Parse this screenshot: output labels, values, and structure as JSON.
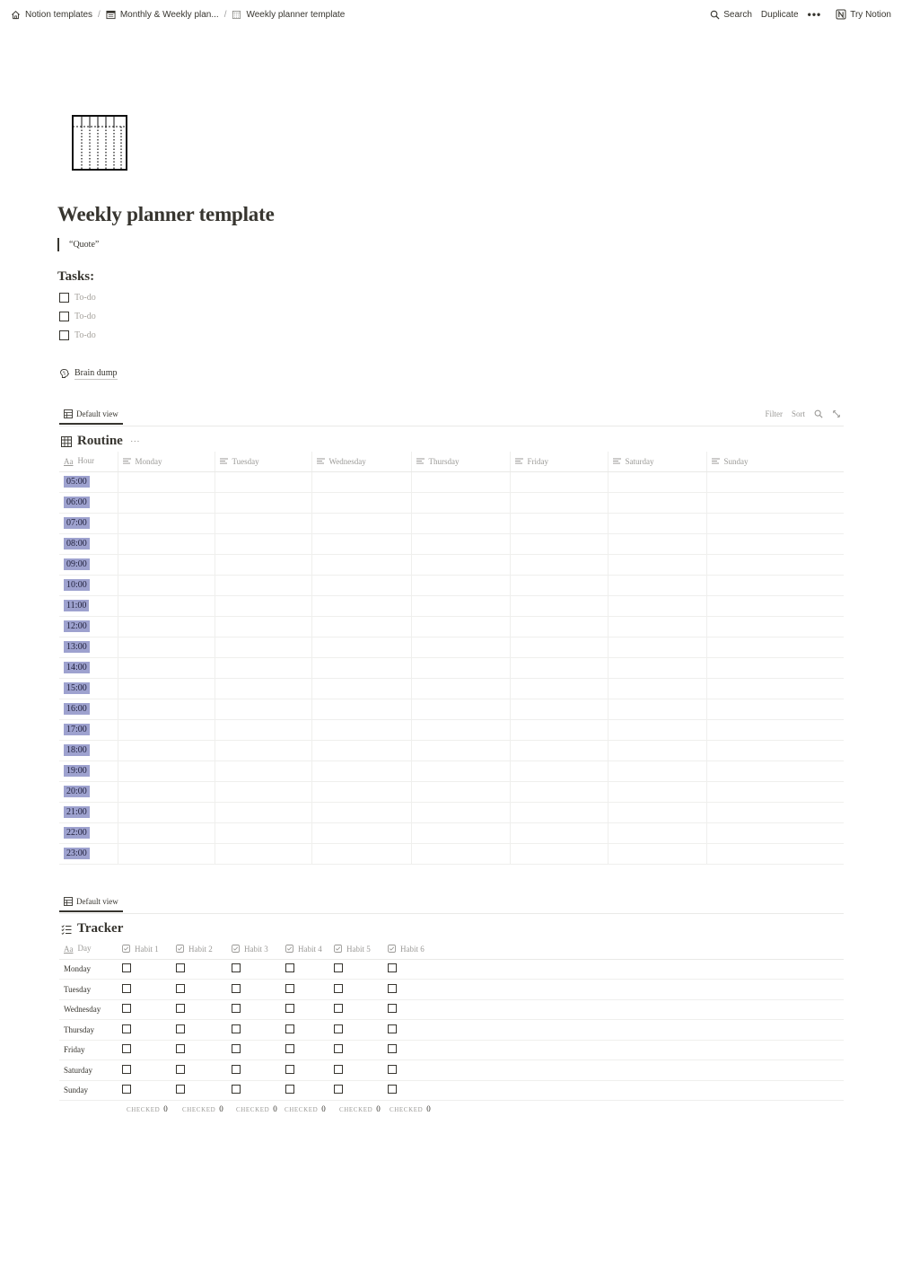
{
  "breadcrumbs": [
    {
      "label": "Notion templates",
      "icon": "home-icon"
    },
    {
      "label": "Monthly & Weekly plan...",
      "icon": "calendar-icon"
    },
    {
      "label": "Weekly planner template",
      "icon": "page-icon"
    }
  ],
  "topbar": {
    "search": "Search",
    "duplicate": "Duplicate",
    "more": "•••",
    "try_notion": "Try Notion"
  },
  "page": {
    "title": "Weekly planner template",
    "quote": "“Quote”",
    "tasks_heading": "Tasks:",
    "todos": [
      "To-do",
      "To-do",
      "To-do"
    ],
    "brain_dump": "Brain dump"
  },
  "routine": {
    "view_tab": "Default view",
    "tools": {
      "filter": "Filter",
      "sort": "Sort"
    },
    "title": "Routine",
    "more": "···",
    "columns": [
      "Hour",
      "Monday",
      "Tuesday",
      "Wednesday",
      "Thursday",
      "Friday",
      "Saturday",
      "Sunday"
    ],
    "hours": [
      "05:00",
      "06:00",
      "07:00",
      "08:00",
      "09:00",
      "10:00",
      "11:00",
      "12:00",
      "13:00",
      "14:00",
      "15:00",
      "16:00",
      "17:00",
      "18:00",
      "19:00",
      "20:00",
      "21:00",
      "22:00",
      "23:00"
    ],
    "hour_highlight_color": "#9ea2cf"
  },
  "tracker": {
    "view_tab": "Default view",
    "title": "Tracker",
    "columns": [
      "Day",
      "Habit 1",
      "Habit 2",
      "Habit 3",
      "Habit 4",
      "Habit 5",
      "Habit 6"
    ],
    "days": [
      "Monday",
      "Tuesday",
      "Wednesday",
      "Thursday",
      "Friday",
      "Saturday",
      "Sunday"
    ],
    "calc_label": "CHECKED",
    "calc_values": [
      "0",
      "0",
      "0",
      "0",
      "0",
      "0"
    ]
  }
}
